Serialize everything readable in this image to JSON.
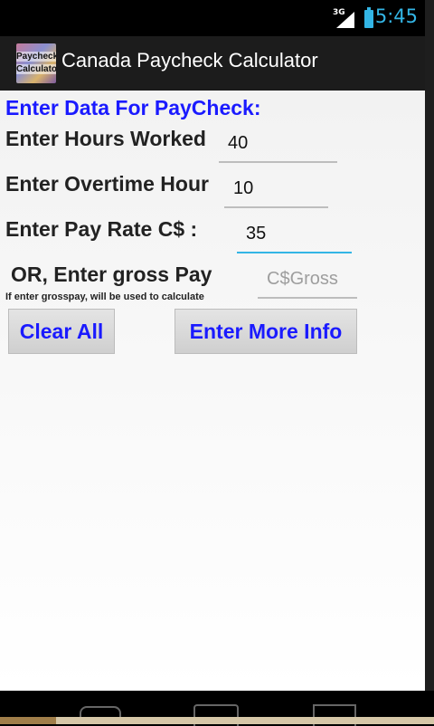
{
  "status_bar": {
    "network": "3G",
    "time": "5:45",
    "accent_color": "#33b5e5"
  },
  "action_bar": {
    "icon_text_line1": "Paycheck",
    "icon_text_line2": "Calculator",
    "title": "Canada Paycheck Calculator"
  },
  "form": {
    "heading": "Enter Data For PayCheck:",
    "hours_label": "Enter Hours Worked",
    "hours_value": "40",
    "overtime_label": "Enter Overtime Hour",
    "overtime_value": "10",
    "rate_label": "Enter Pay Rate C$ :",
    "rate_value": "35",
    "gross_label": "OR, Enter gross Pay",
    "gross_placeholder": "C$Gross",
    "gross_hint": "If enter grosspay, will be used to calculate"
  },
  "buttons": {
    "clear_all": "Clear All",
    "enter_more_info": "Enter More Info"
  },
  "colors": {
    "heading": "#1a1aff",
    "button_text": "#1a1aff",
    "active_field": "#33b5e5"
  }
}
